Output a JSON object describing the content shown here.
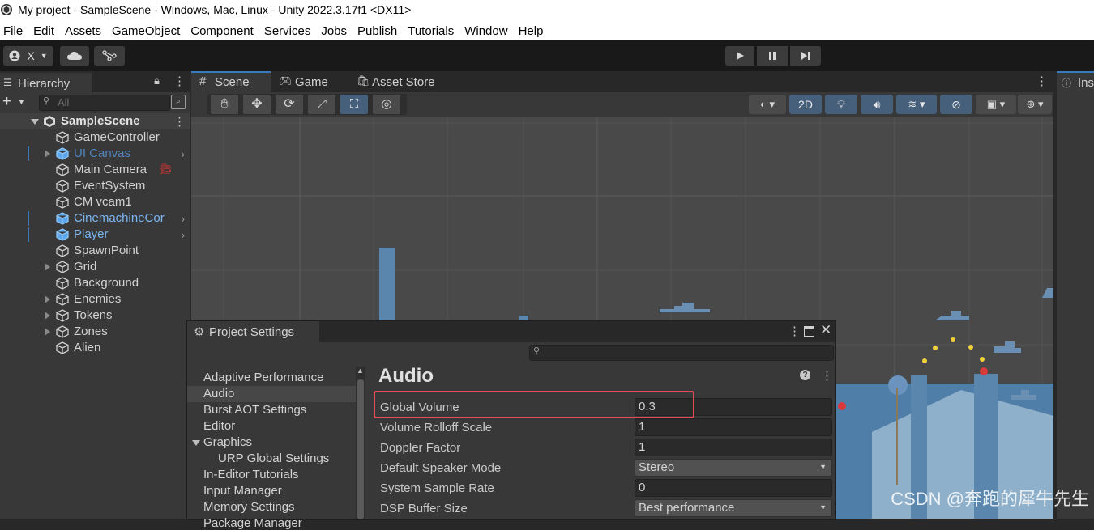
{
  "window": {
    "title": "My project - SampleScene - Windows, Mac, Linux - Unity 2022.3.17f1 <DX11>"
  },
  "menu": [
    "File",
    "Edit",
    "Assets",
    "GameObject",
    "Component",
    "Services",
    "Jobs",
    "Publish",
    "Tutorials",
    "Window",
    "Help"
  ],
  "toolbar": {
    "account_label": "X"
  },
  "hierarchy": {
    "tab": "Hierarchy",
    "search_placeholder": "All",
    "scene": "SampleScene",
    "items": [
      {
        "label": "GameController",
        "prefab": false,
        "expandable": false
      },
      {
        "label": "UI Canvas",
        "prefab": true,
        "expandable": true,
        "dimmed": true
      },
      {
        "label": "Main Camera",
        "prefab": false,
        "expandable": false
      },
      {
        "label": "EventSystem",
        "prefab": false,
        "expandable": false
      },
      {
        "label": "CM vcam1",
        "prefab": false,
        "expandable": false
      },
      {
        "label": "CinemachineCor",
        "prefab": true,
        "expandable": false
      },
      {
        "label": "Player",
        "prefab": true,
        "expandable": false
      },
      {
        "label": "SpawnPoint",
        "prefab": false,
        "expandable": false
      },
      {
        "label": "Grid",
        "prefab": false,
        "expandable": true
      },
      {
        "label": "Background",
        "prefab": false,
        "expandable": false
      },
      {
        "label": "Enemies",
        "prefab": false,
        "expandable": true
      },
      {
        "label": "Tokens",
        "prefab": false,
        "expandable": true
      },
      {
        "label": "Zones",
        "prefab": false,
        "expandable": true
      },
      {
        "label": "Alien",
        "prefab": false,
        "expandable": false
      }
    ]
  },
  "scene_tabs": [
    "Scene",
    "Game",
    "Asset Store"
  ],
  "scene_toolbar": {
    "mode_2d": "2D"
  },
  "inspector": {
    "tab": "Ins"
  },
  "project_settings": {
    "title": "Project Settings",
    "categories": [
      {
        "label": "Adaptive Performance",
        "indent": 0,
        "selected": false
      },
      {
        "label": "Audio",
        "indent": 0,
        "selected": true
      },
      {
        "label": "Burst AOT Settings",
        "indent": 0,
        "selected": false
      },
      {
        "label": "Editor",
        "indent": 0,
        "selected": false
      },
      {
        "label": "Graphics",
        "indent": 0,
        "selected": false,
        "expanded": true
      },
      {
        "label": "URP Global Settings",
        "indent": 1,
        "selected": false
      },
      {
        "label": "In-Editor Tutorials",
        "indent": 0,
        "selected": false
      },
      {
        "label": "Input Manager",
        "indent": 0,
        "selected": false
      },
      {
        "label": "Memory Settings",
        "indent": 0,
        "selected": false
      },
      {
        "label": "Package Manager",
        "indent": 0,
        "selected": false
      }
    ],
    "section": "Audio",
    "fields": [
      {
        "label": "Global Volume",
        "value": "0.3",
        "type": "text"
      },
      {
        "label": "Volume Rolloff Scale",
        "value": "1",
        "type": "text"
      },
      {
        "label": "Doppler Factor",
        "value": "1",
        "type": "text"
      },
      {
        "label": "Default Speaker Mode",
        "value": "Stereo",
        "type": "dropdown"
      },
      {
        "label": "System Sample Rate",
        "value": "0",
        "type": "text"
      },
      {
        "label": "DSP Buffer Size",
        "value": "Best performance",
        "type": "dropdown"
      }
    ]
  },
  "watermark": "CSDN @奔跑的犀牛先生",
  "colors": {
    "accent": "#3a79bb",
    "prefab_text": "#7bb6f2",
    "highlight_box": "#e64a58",
    "tile_blue": "#5a86ae"
  }
}
